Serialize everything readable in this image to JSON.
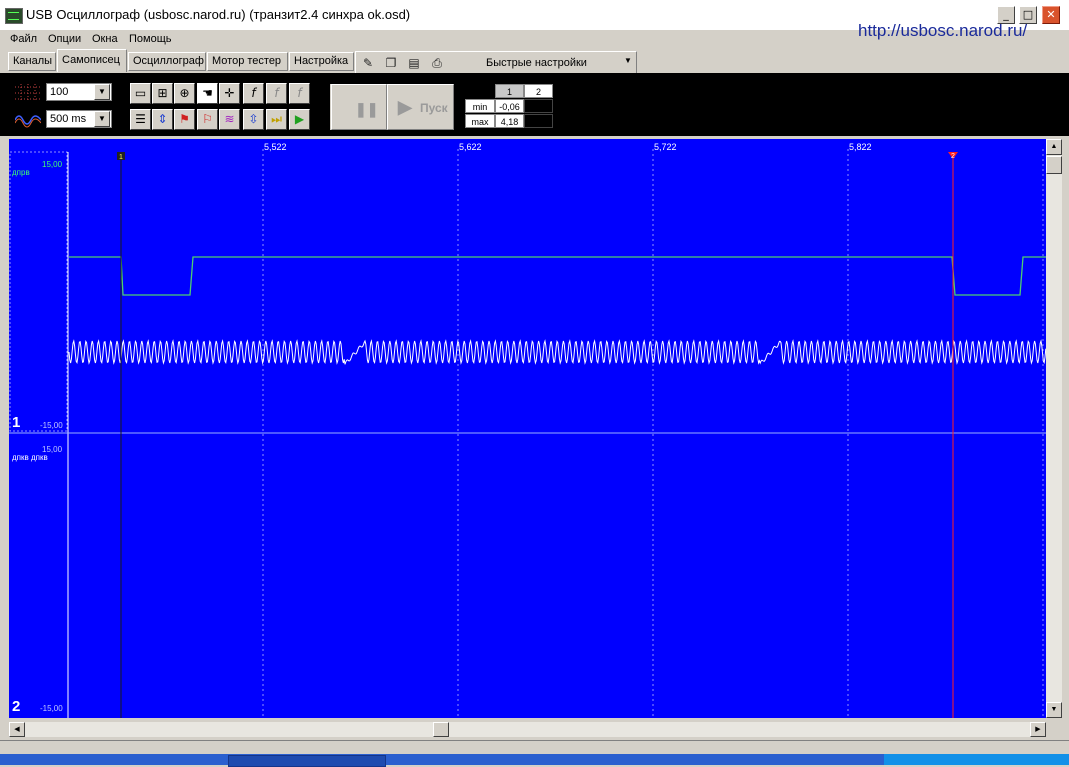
{
  "window": {
    "title": "USB Осциллограф (usbosc.narod.ru) (транзит2.4 синхра ok.osd)",
    "site_url": "http://usbosc.narod.ru/",
    "controls": {
      "minimize": "_",
      "maximize": "□",
      "close": "✕"
    }
  },
  "menu": [
    "Файл",
    "Опции",
    "Окна",
    "Помощь"
  ],
  "tabs": [
    "Каналы",
    "Самописец",
    "Осциллограф",
    "Мотор тестер",
    "Настройка"
  ],
  "active_tab": "Самописец",
  "quick_settings": {
    "label": "Быстрые настройки"
  },
  "toolbar": {
    "points_value": "100",
    "timebase_value": "500 ms",
    "run_label": "Пуск"
  },
  "minmax": {
    "cols": [
      "1",
      "2"
    ],
    "rows": [
      {
        "label": "min",
        "v1": "-0,06",
        "v2": ""
      },
      {
        "label": "max",
        "v1": "4,18",
        "v2": ""
      }
    ]
  },
  "plot": {
    "time_ticks": [
      "5,522",
      "5,622",
      "5,722",
      "5,822"
    ],
    "cursor1_label": "1",
    "cursor2_label": "2",
    "channel1": {
      "number": "1",
      "name": "дпрв",
      "top_label": "15,00",
      "bottom_label": "-15,00"
    },
    "channel2": {
      "number": "2",
      "name": "дпкв дпкв",
      "top_label": "15,00",
      "bottom_label": "-15,00"
    },
    "colors": {
      "background": "#0000ff",
      "trace_square": "#4ecf70",
      "trace_wave": "#ffffff",
      "cursor1": "#1a1a1a",
      "cursor2": "#ff2020"
    }
  }
}
